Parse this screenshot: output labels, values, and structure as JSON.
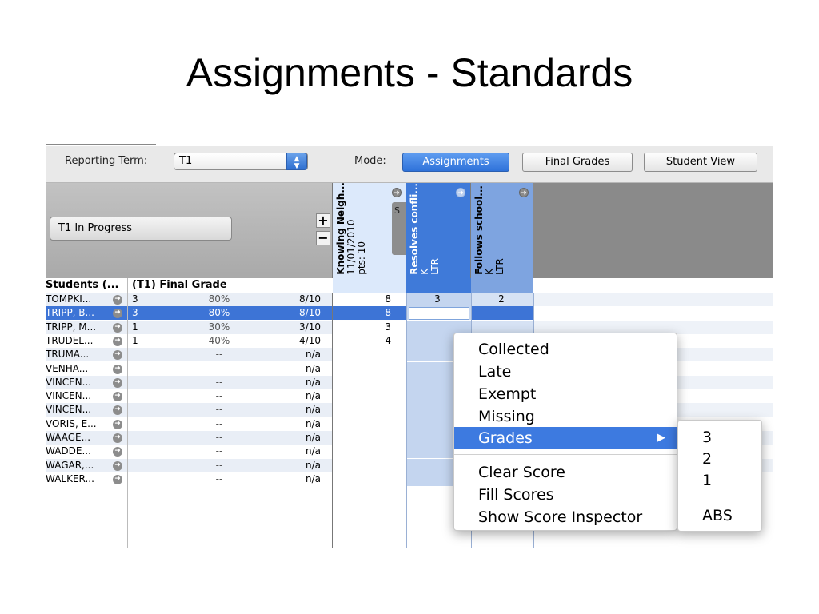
{
  "slide": {
    "title": "Assignments - Standards"
  },
  "toolbar": {
    "reporting_term_label": "Reporting Term:",
    "reporting_term_value": "T1",
    "mode_label": "Mode:",
    "modes": [
      "Assignments",
      "Final Grades",
      "Student View"
    ],
    "active_mode": "Assignments"
  },
  "left_header": {
    "progress_button": "T1 In Progress",
    "plus": "+",
    "minus": "−"
  },
  "columns": {
    "students": "Students (...",
    "final_grade": "(T1) Final Grade"
  },
  "standards": [
    {
      "line1": "Knowing Neigh...",
      "line2": "11/01/2010",
      "line3": "pts: 10",
      "tab": "S"
    },
    {
      "line1": "Resolves confli...",
      "line2": "K",
      "line3": "LTR"
    },
    {
      "line1": "Follows school...",
      "line2": "K",
      "line3": "LTR"
    }
  ],
  "students": [
    {
      "name": "TOMPKI...",
      "grade": "3",
      "pct": "80%",
      "pts": "8/10",
      "s1": "8",
      "s2": "3",
      "s3": "2"
    },
    {
      "name": "TRIPP, B...",
      "grade": "3",
      "pct": "80%",
      "pts": "8/10",
      "s1": "8",
      "s2": "",
      "s3": ""
    },
    {
      "name": "TRIPP, M...",
      "grade": "1",
      "pct": "30%",
      "pts": "3/10",
      "s1": "3",
      "s2": "",
      "s3": ""
    },
    {
      "name": "TRUDEL...",
      "grade": "1",
      "pct": "40%",
      "pts": "4/10",
      "s1": "4",
      "s2": "",
      "s3": ""
    },
    {
      "name": "TRUMA...",
      "grade": "",
      "pct": "--",
      "pts": "n/a",
      "s1": "",
      "s2": "",
      "s3": ""
    },
    {
      "name": "VENHA...",
      "grade": "",
      "pct": "--",
      "pts": "n/a",
      "s1": "",
      "s2": "",
      "s3": ""
    },
    {
      "name": "VINCEN...",
      "grade": "",
      "pct": "--",
      "pts": "n/a",
      "s1": "",
      "s2": "",
      "s3": ""
    },
    {
      "name": "VINCEN...",
      "grade": "",
      "pct": "--",
      "pts": "n/a",
      "s1": "",
      "s2": "",
      "s3": ""
    },
    {
      "name": "VINCEN...",
      "grade": "",
      "pct": "--",
      "pts": "n/a",
      "s1": "",
      "s2": "",
      "s3": ""
    },
    {
      "name": "VORIS, E...",
      "grade": "",
      "pct": "--",
      "pts": "n/a",
      "s1": "",
      "s2": "",
      "s3": ""
    },
    {
      "name": "WAAGE...",
      "grade": "",
      "pct": "--",
      "pts": "n/a",
      "s1": "",
      "s2": "",
      "s3": ""
    },
    {
      "name": "WADDE...",
      "grade": "",
      "pct": "--",
      "pts": "n/a",
      "s1": "",
      "s2": "",
      "s3": ""
    },
    {
      "name": "WAGAR,...",
      "grade": "",
      "pct": "--",
      "pts": "n/a",
      "s1": "",
      "s2": "",
      "s3": ""
    },
    {
      "name": "WALKER...",
      "grade": "",
      "pct": "--",
      "pts": "n/a",
      "s1": "",
      "s2": "",
      "s3": ""
    }
  ],
  "selected_row_index": 1,
  "context_menu": {
    "items": [
      "Collected",
      "Late",
      "Exempt",
      "Missing",
      "Grades",
      "Clear Score",
      "Fill Scores",
      "Show Score Inspector"
    ],
    "highlighted": "Grades",
    "submenu_arrow": "▶"
  },
  "grades_submenu": {
    "items": [
      "3",
      "2",
      "1",
      "ABS"
    ]
  },
  "colors": {
    "accent": "#3d7ae0",
    "active_column_header": "#3f7ad9",
    "active_column_body": "#c4d5ef",
    "first_column_header": "#dce9fb",
    "selected_row": "#3d74d6"
  },
  "icons": {
    "row_action": "circle-arrow-icon",
    "term_stepper": "up-down-arrows-icon"
  }
}
